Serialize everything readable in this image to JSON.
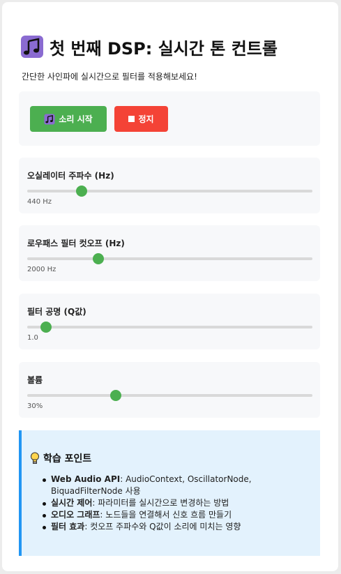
{
  "header": {
    "title": "첫 번째 DSP: 실시간 톤 컨트롤",
    "subtitle": "간단한 사인파에 실시간으로 필터를 적용해보세요!"
  },
  "controls": {
    "start_label": "소리 시작",
    "stop_label": "정지",
    "start_color": "#4caf50",
    "stop_color": "#f44336"
  },
  "sliders": [
    {
      "label": "오실레이터 주파수 (Hz)",
      "value_text": "440 Hz",
      "level": 0.19
    },
    {
      "label": "로우패스 필터 컷오프 (Hz)",
      "value_text": "2000 Hz",
      "level": 0.25
    },
    {
      "label": "필터 공명 (Q값)",
      "value_text": "1.0",
      "level": 0.065
    },
    {
      "label": "볼륨",
      "value_text": "30%",
      "level": 0.31
    }
  ],
  "learning": {
    "title": "학습 포인트",
    "items": [
      {
        "term": "Web Audio API",
        "desc": ": AudioContext, OscillatorNode, BiquadFilterNode 사용"
      },
      {
        "term": "실시간 제어",
        "desc": ": 파라미터를 실시간으로 변경하는 방법"
      },
      {
        "term": "오디오 그래프",
        "desc": ": 노드들을 연결해서 신호 흐름 만들기"
      },
      {
        "term": "필터 효과",
        "desc": ": 컷오프 주파수와 Q값이 소리에 미치는 영향"
      }
    ]
  },
  "icons": {
    "title_icon": "musical-notes-icon",
    "start_icon": "musical-notes-icon",
    "stop_icon": "stop-square-icon",
    "learning_icon": "lightbulb-icon"
  },
  "colors": {
    "accent_green": "#4caf50",
    "info_blue": "#2196f3",
    "info_bg": "#e3f2fd"
  }
}
